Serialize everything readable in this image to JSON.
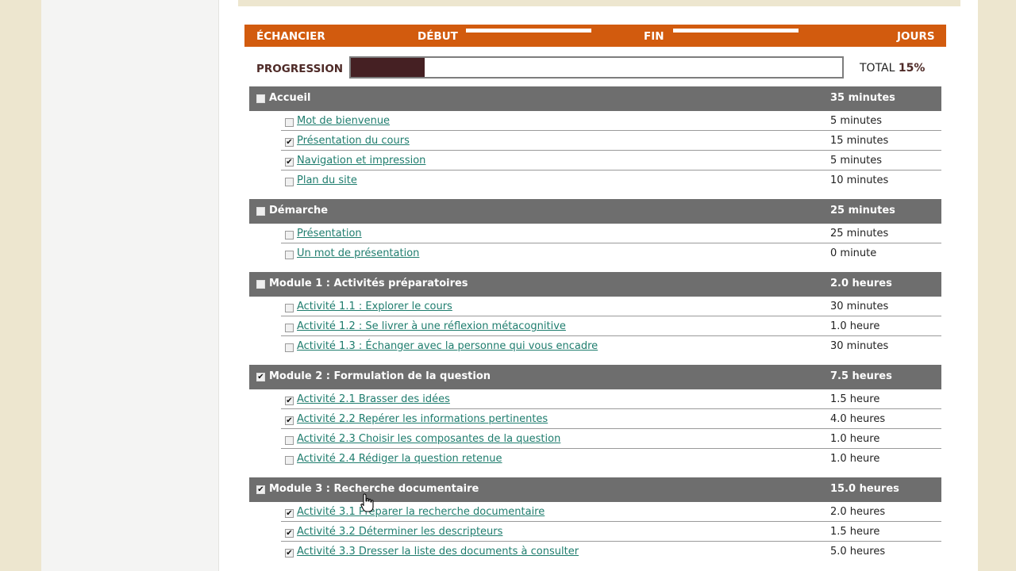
{
  "schedule": {
    "label_schedule": "ÉCHANCIER",
    "label_start": "DÉBUT",
    "label_end": "FIN",
    "label_days": "JOURS",
    "start_value": "",
    "end_value": ""
  },
  "progress": {
    "label": "PROGRESSION",
    "total_label": "TOTAL",
    "total_value": "15%",
    "fraction": 0.15
  },
  "sections": [
    {
      "title": "Accueil",
      "duration": "35 minutes",
      "checked": false,
      "items": [
        {
          "title": "Mot de bienvenue",
          "duration": "5 minutes",
          "checked": false
        },
        {
          "title": "Présentation du cours",
          "duration": "15 minutes",
          "checked": true
        },
        {
          "title": "Navigation et impression",
          "duration": "5 minutes",
          "checked": true
        },
        {
          "title": "Plan du site",
          "duration": "10 minutes",
          "checked": false
        }
      ]
    },
    {
      "title": "Démarche",
      "duration": "25 minutes",
      "checked": false,
      "items": [
        {
          "title": "Présentation",
          "duration": "25 minutes",
          "checked": false
        },
        {
          "title": "Un mot de présentation",
          "duration": "0 minute",
          "checked": false
        }
      ]
    },
    {
      "title": "Module 1 : Activités préparatoires",
      "duration": "2.0 heures",
      "checked": false,
      "items": [
        {
          "title": "Activité 1.1 : Explorer le cours",
          "duration": "30 minutes",
          "checked": false
        },
        {
          "title": "Activité 1.2 : Se livrer à une réflexion métacognitive",
          "duration": "1.0 heure",
          "checked": false
        },
        {
          "title": "Activité 1.3 : Échanger avec la personne qui vous encadre",
          "duration": "30 minutes",
          "checked": false
        }
      ]
    },
    {
      "title": "Module 2 : Formulation de la question",
      "duration": "7.5 heures",
      "checked": true,
      "items": [
        {
          "title": "Activité 2.1 Brasser des idées",
          "duration": "1.5 heure",
          "checked": true
        },
        {
          "title": "Activité 2.2 Repérer les informations pertinentes",
          "duration": "4.0 heures",
          "checked": true
        },
        {
          "title": "Activité 2.3 Choisir les composantes de la question",
          "duration": "1.0 heure",
          "checked": false
        },
        {
          "title": "Activité 2.4 Rédiger la question retenue",
          "duration": "1.0 heure",
          "checked": false
        }
      ]
    },
    {
      "title": "Module 3 : Recherche documentaire",
      "duration": "15.0 heures",
      "checked": true,
      "items": [
        {
          "title": "Activité 3.1 Préparer la recherche documentaire",
          "duration": "2.0 heures",
          "checked": true
        },
        {
          "title": "Activité 3.2 Déterminer les descripteurs",
          "duration": "1.5 heure",
          "checked": true
        },
        {
          "title": "Activité 3.3 Dresser la liste des documents à consulter",
          "duration": "5.0 heures",
          "checked": true
        }
      ]
    }
  ]
}
